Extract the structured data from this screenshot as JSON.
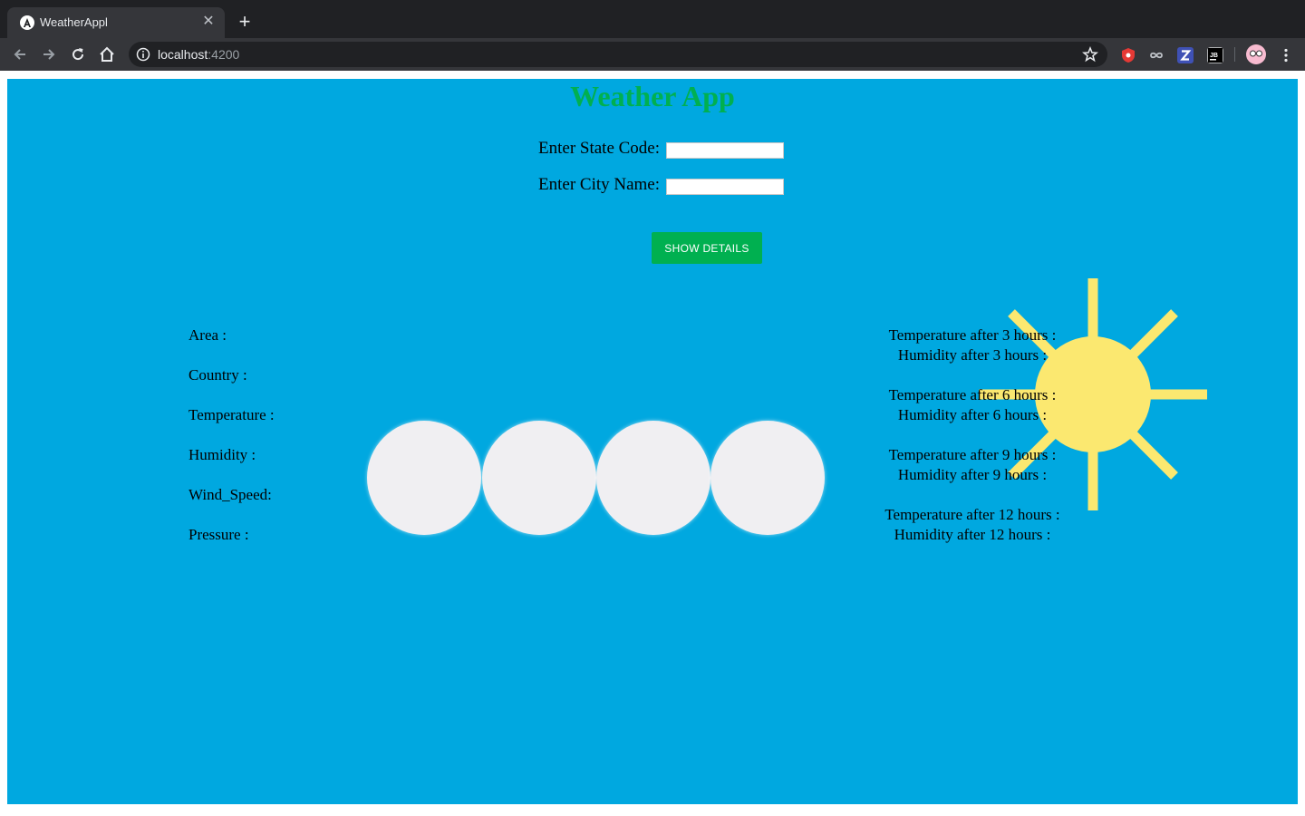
{
  "browser": {
    "tab_title": "WeatherAppl",
    "url_host": "localhost",
    "url_port": ":4200"
  },
  "page": {
    "title": "Weather App",
    "state_code_label": "Enter State Code:",
    "city_name_label": "Enter City Name:",
    "state_code_value": "",
    "city_name_value": "",
    "show_button_label": "SHOW DETAILS",
    "left_fields": [
      "Area :",
      "Country :",
      "Temperature :",
      "Humidity :",
      "Wind_Speed:",
      "Pressure :"
    ],
    "forecast": [
      {
        "temp": "Temperature after 3 hours :",
        "humidity": "Humidity after 3 hours :"
      },
      {
        "temp": "Temperature after 6 hours :",
        "humidity": "Humidity after 6 hours :"
      },
      {
        "temp": "Temperature after 9 hours :",
        "humidity": "Humidity after 9 hours :"
      },
      {
        "temp": "Temperature after 12 hours :",
        "humidity": "Humidity after 12 hours :"
      }
    ]
  },
  "colors": {
    "background": "#00a8e0",
    "accent": "#00b050",
    "sun": "#fbe870"
  }
}
